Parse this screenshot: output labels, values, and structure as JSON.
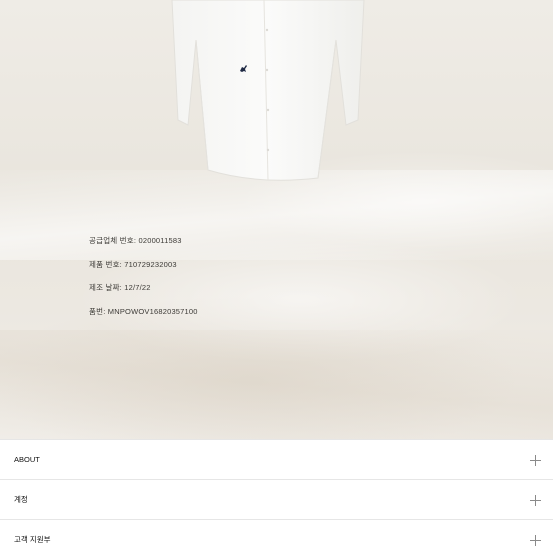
{
  "product_info": {
    "supplier_no": "공급업체 번호: 0200011583",
    "product_no": "제품 번호: 710729232003",
    "manufacture_date": "제조 날짜: 12/7/22",
    "tracking_no": "품번: MNPOWOV16820357100"
  },
  "footer_menu": {
    "items": [
      {
        "label": "ABOUT",
        "icon": "plus-icon"
      },
      {
        "label": "계정",
        "icon": "plus-icon"
      },
      {
        "label": "고객 지원부",
        "icon": "plus-icon"
      }
    ]
  },
  "colors": {
    "background": "#ffffff",
    "hero_bg": "#ece8e1",
    "divider": "#e6e6e6",
    "logo": "#1f2a44"
  }
}
